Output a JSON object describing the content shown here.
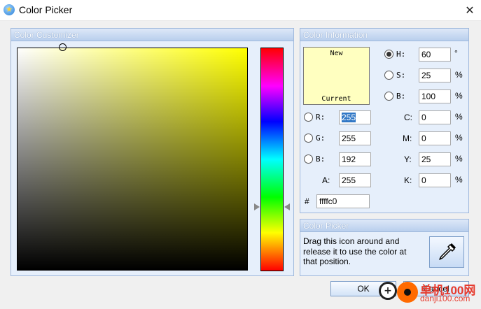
{
  "window": {
    "title": "Color Picker",
    "close_symbol": "✕",
    "icon": "app-star-icon"
  },
  "customizer": {
    "header": "Color Customizer"
  },
  "info": {
    "header": "Color Information",
    "swatch_new": "New",
    "swatch_current": "Current",
    "swatch_color": "#ffffc0",
    "h_label": "H:",
    "h_value": "60",
    "h_unit": "°",
    "s_label": "S:",
    "s_value": "25",
    "s_unit": "%",
    "b_label": "B:",
    "b_value": "100",
    "b_unit": "%",
    "r_label": "R:",
    "r_value": "255",
    "g_label": "G:",
    "g_value": "255",
    "blue_label": "B:",
    "blue_value": "192",
    "a_label": "A:",
    "a_value": "255",
    "c_label": "C:",
    "c_value": "0",
    "c_unit": "%",
    "m_label": "M:",
    "m_value": "0",
    "m_unit": "%",
    "y_label": "Y:",
    "y_value": "25",
    "y_unit": "%",
    "k_label": "K:",
    "k_value": "0",
    "k_unit": "%",
    "hex_label": "#",
    "hex_value": "ffffc0",
    "selected_mode": "H"
  },
  "picker": {
    "header": "Color Picker",
    "description": "Drag this icon around and release it to use the color at that position.",
    "icon": "eyedropper-icon"
  },
  "buttons": {
    "ok": "OK",
    "cancel": "Cancel"
  },
  "watermark": {
    "line1": "单机100网",
    "line2": "danji100.com"
  },
  "colors": {
    "panel_bg": "#e6effb",
    "panel_border": "#9fb8dc",
    "hue": "#ffff00"
  }
}
